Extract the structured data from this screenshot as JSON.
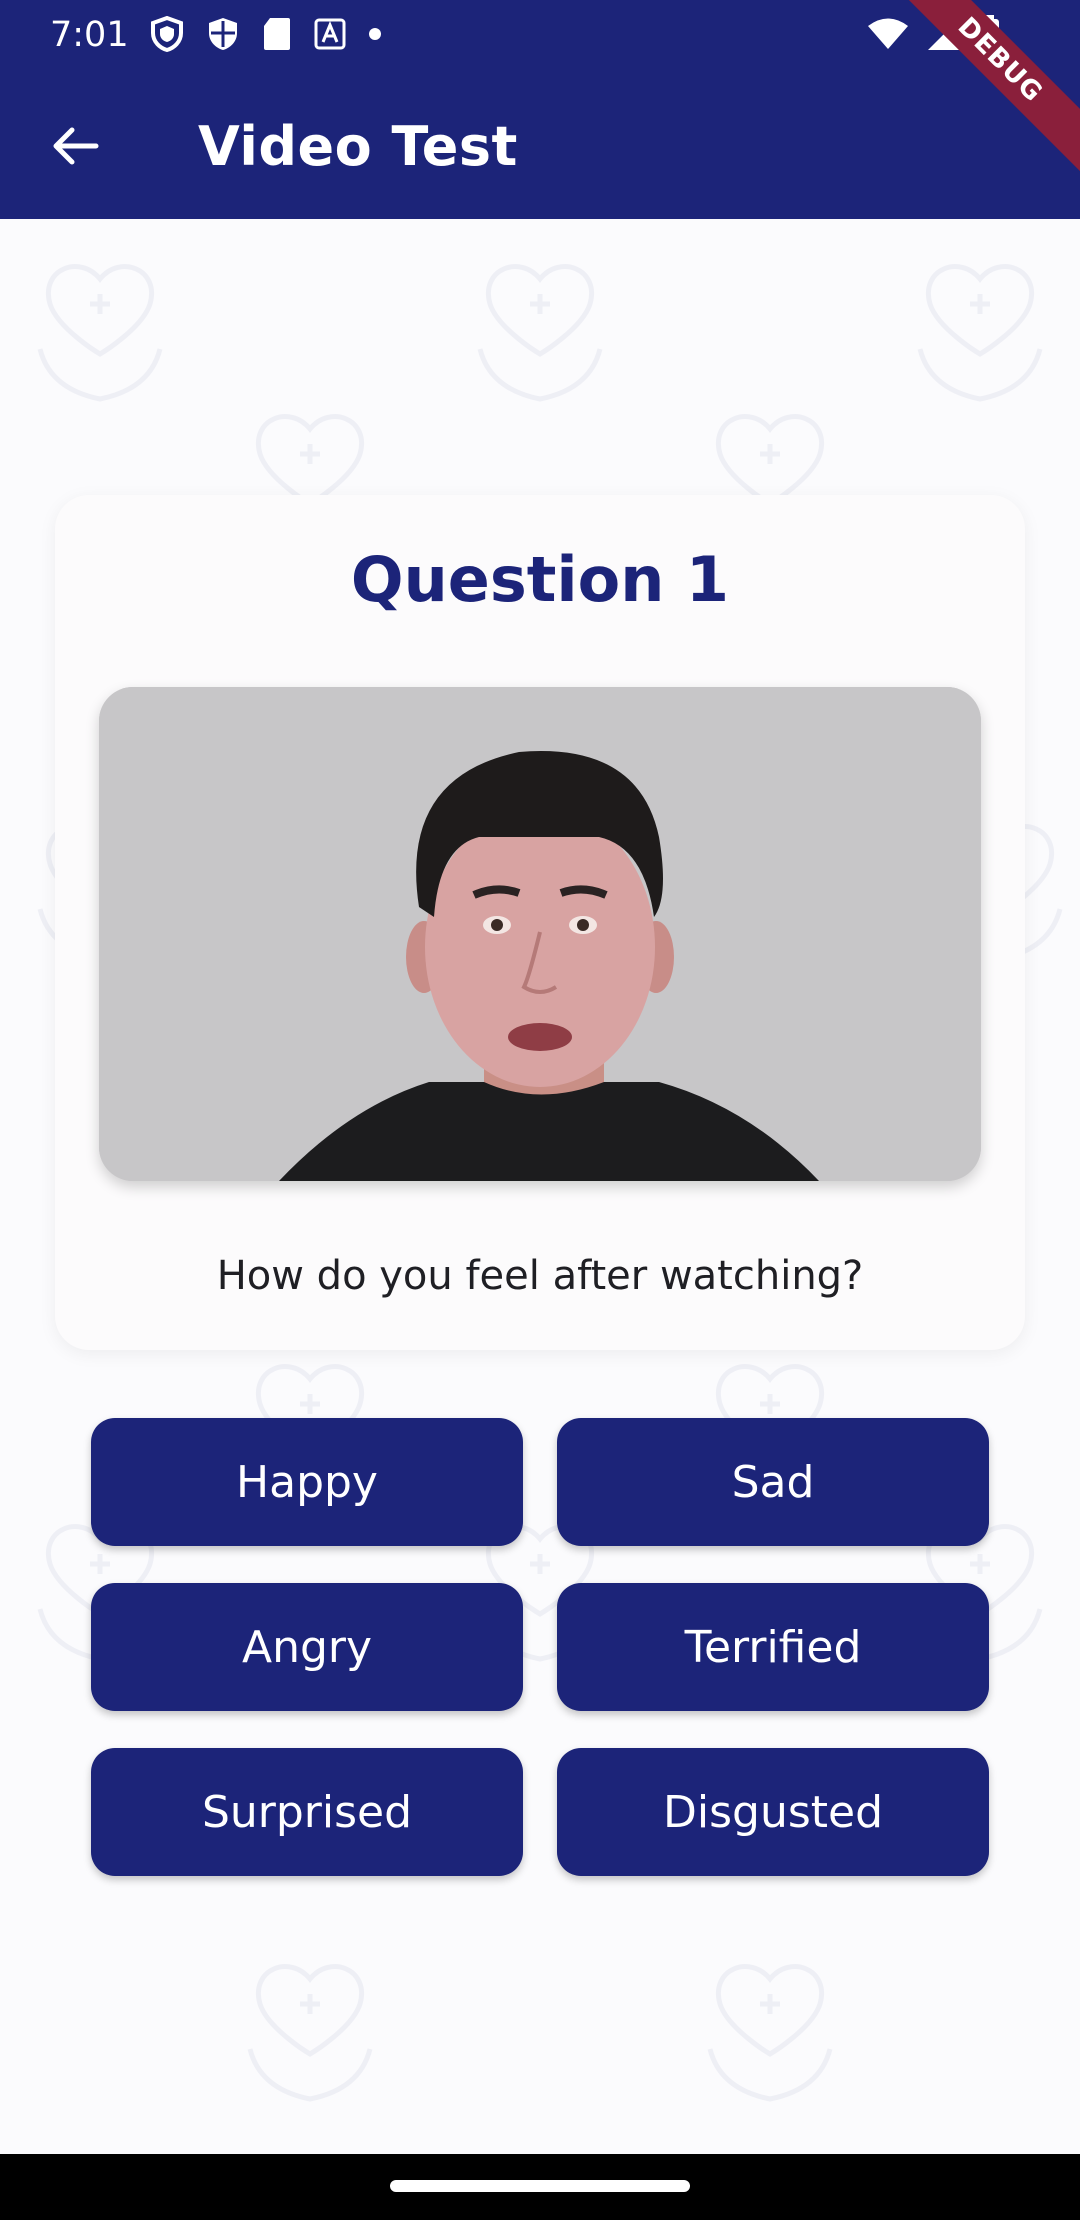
{
  "status_bar": {
    "time": "7:01",
    "icons_left": [
      "shield-icon",
      "shield-icon",
      "sd-card-icon",
      "text-a-icon",
      "dot-icon"
    ],
    "icons_right": [
      "wifi-icon",
      "signal-icon",
      "battery-icon"
    ]
  },
  "app_bar": {
    "title": "Video Test",
    "back_icon": "arrow-left-icon",
    "debug_label": "DEBUG",
    "color": "#1c2479"
  },
  "card": {
    "title": "Question 1",
    "prompt": "How do you feel after watching?"
  },
  "answers": [
    "Happy",
    "Sad",
    "Angry",
    "Terrified",
    "Surprised",
    "Disgusted"
  ],
  "colors": {
    "primary": "#1c2479",
    "debug_ribbon": "#8a1f3b",
    "background": "#fbfbfd"
  }
}
